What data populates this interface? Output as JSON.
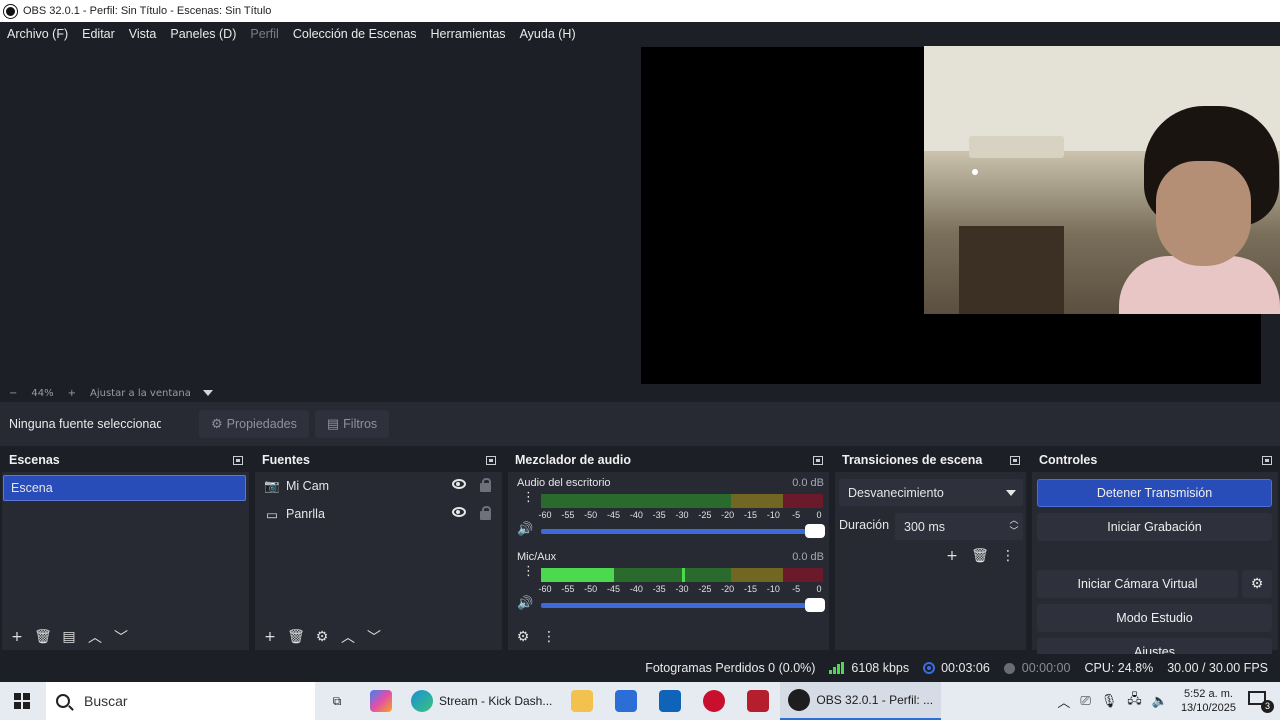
{
  "titlebar": {
    "title": "OBS 32.0.1 - Perfil: Sin Título - Escenas: Sin Título"
  },
  "menu": [
    {
      "label": "Archivo (F)",
      "disabled": false
    },
    {
      "label": "Editar",
      "disabled": false
    },
    {
      "label": "Vista",
      "disabled": false
    },
    {
      "label": "Paneles (D)",
      "disabled": false
    },
    {
      "label": "Perfil",
      "disabled": true
    },
    {
      "label": "Colección de Escenas",
      "disabled": false
    },
    {
      "label": "Herramientas",
      "disabled": false
    },
    {
      "label": "Ayuda (H)",
      "disabled": false
    }
  ],
  "zoom": {
    "minus": "−",
    "value": "44%",
    "plus": "+",
    "fit": "Ajustar a la ventana"
  },
  "sourcebar": {
    "no_selection": "Ninguna fuente seleccionada",
    "properties": "Propiedades",
    "filters": "Filtros"
  },
  "scenes": {
    "title": "Escenas",
    "items": [
      "Escena"
    ]
  },
  "sources": {
    "title": "Fuentes",
    "items": [
      {
        "name": "Mi Cam",
        "icon": "camera-icon"
      },
      {
        "name": "Panrlla",
        "icon": "monitor-icon"
      }
    ]
  },
  "mixer": {
    "title": "Mezclador de audio",
    "scale": [
      "-60",
      "-55",
      "-50",
      "-45",
      "-40",
      "-35",
      "-30",
      "-25",
      "-20",
      "-15",
      "-10",
      "-5",
      "0"
    ],
    "channels": [
      {
        "name": "Audio del escritorio",
        "db": "0.0 dB",
        "level": 0.0,
        "peak": 0.0,
        "volume": 1.0
      },
      {
        "name": "Mic/Aux",
        "db": "0.0 dB",
        "level": 0.26,
        "peak": 0.5,
        "volume": 1.0
      }
    ]
  },
  "transitions": {
    "title": "Transiciones de escena",
    "selected": "Desvanecimiento",
    "duration_label": "Duración",
    "duration_value": "300 ms"
  },
  "controls": {
    "title": "Controles",
    "stop_stream": "Detener Transmisión",
    "start_recording": "Iniciar Grabación",
    "start_virtual_cam": "Iniciar Cámara Virtual",
    "studio_mode": "Modo Estudio",
    "settings": "Ajustes"
  },
  "status": {
    "dropped_frames": "Fotogramas Perdidos 0 (0.0%)",
    "bitrate": "6108 kbps",
    "stream_time": "00:03:06",
    "rec_time": "00:00:00",
    "cpu": "CPU: 24.8%",
    "fps": "30.00 / 30.00 FPS"
  },
  "taskbar": {
    "search_placeholder": "Buscar",
    "edge_app": "Stream - Kick Dash...",
    "obs_app": "OBS 32.0.1 - Perfil: ...",
    "time": "5:52 a. m.",
    "date": "13/10/2025",
    "notifications": "3"
  },
  "colors": {
    "accent": "#284cb8",
    "panel": "#272a33",
    "background": "#1d1f26",
    "meter_green": "#4dd94d"
  }
}
